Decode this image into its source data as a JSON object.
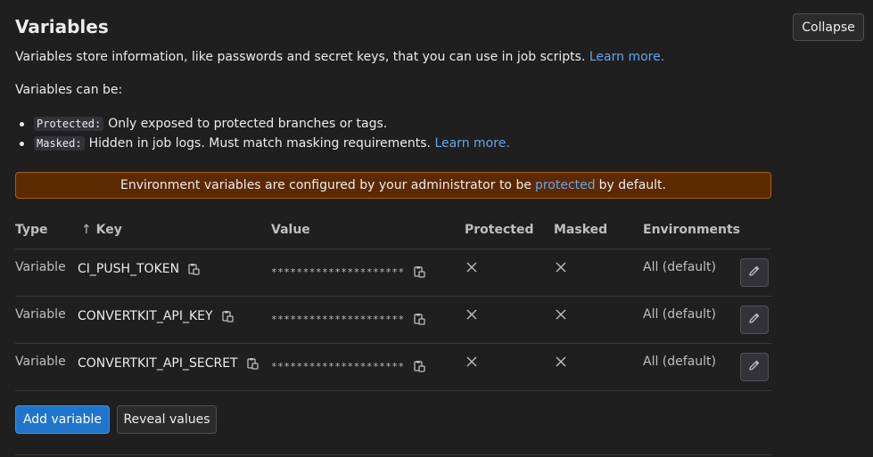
{
  "header": {
    "title": "Variables",
    "collapse_label": "Collapse"
  },
  "intro": {
    "description": "Variables store information, like passwords and secret keys, that you can use in job scripts.",
    "learn_more": "Learn more.",
    "can_be": "Variables can be:"
  },
  "bullets": [
    {
      "code": "Protected:",
      "text": "Only exposed to protected branches or tags.",
      "link": ""
    },
    {
      "code": "Masked:",
      "text": "Hidden in job logs. Must match masking requirements.",
      "link": "Learn more."
    }
  ],
  "alert": {
    "before": "Environment variables are configured by your administrator to be",
    "link": "protected",
    "after": "by default.",
    "bg_color": "#5c2900"
  },
  "table": {
    "headers": {
      "type": "Type",
      "sort_arrow": "↑",
      "key": "Key",
      "value": "Value",
      "protected": "Protected",
      "masked": "Masked",
      "environments": "Environments"
    },
    "rows": [
      {
        "type": "Variable",
        "key": "CI_PUSH_TOKEN",
        "value": "*********************",
        "protected_icon": "close-icon",
        "masked_icon": "close-icon",
        "environment": "All (default)"
      },
      {
        "type": "Variable",
        "key": "CONVERTKIT_API_KEY",
        "value": "*********************",
        "protected_icon": "close-icon",
        "masked_icon": "close-icon",
        "environment": "All (default)"
      },
      {
        "type": "Variable",
        "key": "CONVERTKIT_API_SECRET",
        "value": "*********************",
        "protected_icon": "close-icon",
        "masked_icon": "close-icon",
        "environment": "All (default)"
      }
    ]
  },
  "actions": {
    "add_label": "Add variable",
    "reveal_label": "Reveal values",
    "accent_color": "#1f75cb"
  }
}
